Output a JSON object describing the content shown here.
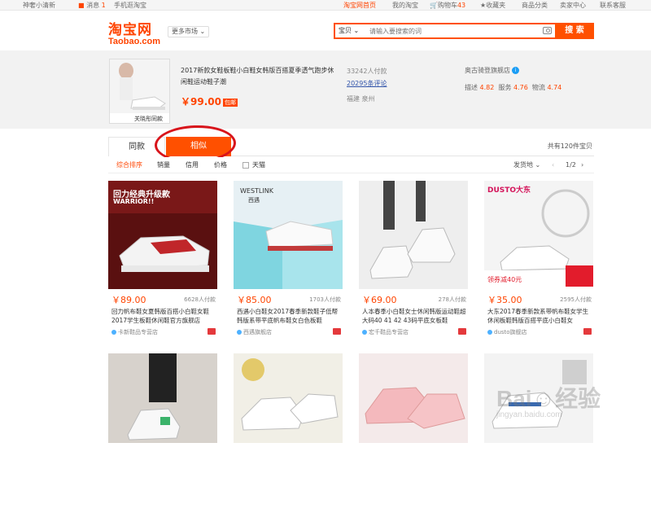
{
  "topbar": {
    "user": "神奢小清新",
    "messages_label": "消息",
    "messages_count": "1",
    "mobile": "手机逛淘宝",
    "home": "淘宝网首页",
    "my_taobao": "我的淘宝",
    "cart_label": "购物车",
    "cart_count": "43",
    "favorites": "收藏夹",
    "categories": "商品分类",
    "seller_center": "卖家中心",
    "contact": "联系客服"
  },
  "header": {
    "logo_cn": "淘宝网",
    "logo_en": "Taobao.com",
    "more_market": "更多市场",
    "search_type": "宝贝",
    "search_placeholder": "请输入要搜索的词",
    "search_button": "搜 索"
  },
  "product": {
    "thumb_label": "关晓彤同款",
    "title": "2017新款女鞋板鞋小白鞋女韩版百搭夏季透气跑步休闲鞋运动鞋子潮",
    "price": "￥99.00",
    "discount": "包邮",
    "paid_count": "33242人付款",
    "reviews": "20295条评论",
    "location": "福建 泉州",
    "shop_name": "奥古骑登旗舰店",
    "rating_desc_label": "描述",
    "rating_desc": "4.82",
    "rating_service_label": "服务",
    "rating_service": "4.76",
    "rating_logistics_label": "物流",
    "rating_logistics": "4.74"
  },
  "tabs": {
    "same": "同款",
    "similar": "相似",
    "total": "共有120件宝贝"
  },
  "sortbar": {
    "comprehensive": "综合排序",
    "sales": "销量",
    "credit": "信用",
    "price": "价格",
    "tmall": "天猫",
    "ship_from": "发货地",
    "page": "1/2"
  },
  "cards": [
    {
      "price": "￥89.00",
      "paid": "6628人付款",
      "title": "回力帆布鞋女夏韩版百搭小白鞋女鞋2017学生板鞋休闲鞋官方旗舰店",
      "shop": "卡新鞋品专营店",
      "img_caption": "回力经典升级款",
      "img_caption2": "WARRIOR!!"
    },
    {
      "price": "￥85.00",
      "paid": "1703人付款",
      "title": "西遇小白鞋女2017春季新款鞋子低帮韩版系带平底帆布鞋女白色板鞋",
      "shop": "西遇旗舰店",
      "img_caption": "WESTLINK",
      "img_caption2": "西遇"
    },
    {
      "price": "￥69.00",
      "paid": "278人付款",
      "title": "人本春季小白鞋女士休闲韩版运动鞋超大码40 41 42 43码平底女板鞋",
      "shop": "宏千鞋品专营店",
      "img_caption": "",
      "img_caption2": ""
    },
    {
      "price": "￥35.00",
      "paid": "2595人付款",
      "title": "大东2017春季新款系带帆布鞋女学生休闲板鞋韩版百搭平底小白鞋女",
      "shop": "dusto旗舰店",
      "img_caption": "DUSTO大东",
      "img_caption2": "领券减40元"
    }
  ],
  "watermark": {
    "main": "Bai☺经验",
    "sub": "jingyan.baidu.com"
  }
}
